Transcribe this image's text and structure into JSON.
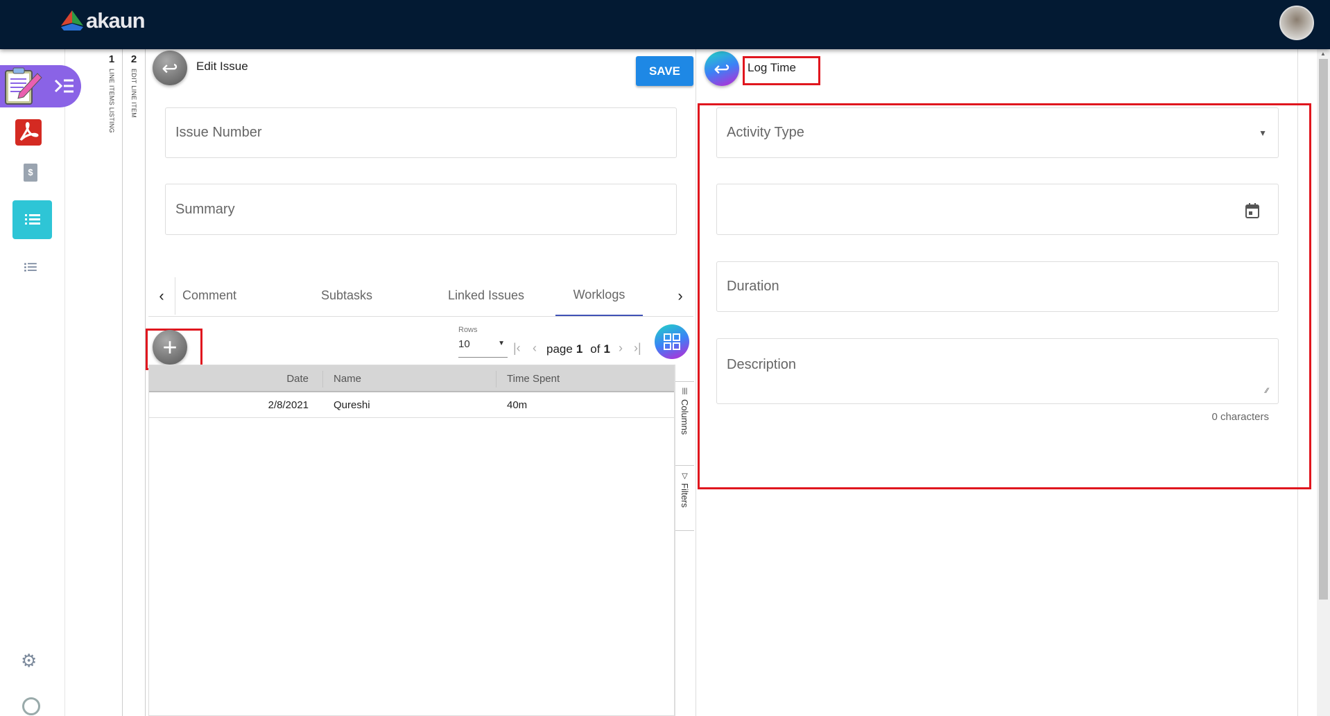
{
  "header": {
    "logo_text": "akaun"
  },
  "stepper": [
    {
      "num": "1",
      "label": "LINE ITEMS LISTING"
    },
    {
      "num": "2",
      "label": "EDIT LINE ITEM"
    }
  ],
  "edit_issue": {
    "title": "Edit Issue",
    "save_label": "SAVE",
    "fields": {
      "issue_number": "Issue Number",
      "summary": "Summary"
    },
    "tabs": [
      "Comment",
      "Subtasks",
      "Linked Issues",
      "Worklogs"
    ],
    "active_tab": "Worklogs",
    "pagination": {
      "rows_label": "Rows",
      "rows_value": "10",
      "page_label": "page",
      "page": "1",
      "of_label": "of",
      "total": "1"
    },
    "table": {
      "columns": [
        "Date",
        "Name",
        "Time Spent"
      ],
      "rows": [
        {
          "date": "2/8/2021",
          "name": "Qureshi",
          "time_spent": "40m"
        }
      ]
    },
    "side_tools": [
      "Columns",
      "Filters"
    ]
  },
  "log_time": {
    "title": "Log Time",
    "fields": {
      "activity_type": "Activity Type",
      "date": "",
      "duration": "Duration",
      "description": "Description"
    },
    "char_count": "0 characters"
  },
  "colors": {
    "topbar": "#031a33",
    "accent": "#1e88e5",
    "highlight": "#e0161e",
    "sidebar_active": "#8a63e6",
    "teal": "#2ec5d6"
  }
}
